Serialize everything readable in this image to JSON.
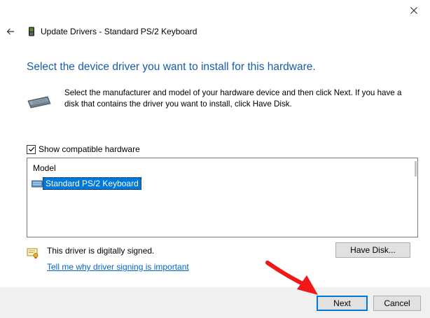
{
  "window": {
    "title": "Update Drivers - Standard PS/2 Keyboard"
  },
  "page": {
    "heading": "Select the device driver you want to install for this hardware.",
    "instructions": "Select the manufacturer and model of your hardware device and then click Next. If you have a disk that contains the driver you want to install, click Have Disk.",
    "show_compatible_label": "Show compatible hardware",
    "show_compatible_checked": true,
    "model_list": {
      "header": "Model",
      "items": [
        {
          "label": "Standard PS/2 Keyboard",
          "selected": true
        }
      ]
    },
    "signed_text": "This driver is digitally signed.",
    "signing_link": "Tell me why driver signing is important",
    "have_disk_label": "Have Disk..."
  },
  "footer": {
    "next_label": "Next",
    "cancel_label": "Cancel"
  },
  "colors": {
    "heading": "#1a5ca6",
    "selection": "#0078d7",
    "link": "#0066cc",
    "annotation_arrow": "#f01818"
  },
  "icons": {
    "close": "close-icon",
    "back": "back-arrow-icon",
    "title": "keyboard-device-icon",
    "device": "keyboard-icon",
    "list_item": "keyboard-item-icon",
    "signed": "certificate-shield-icon",
    "checkbox": "checkmark-icon"
  }
}
